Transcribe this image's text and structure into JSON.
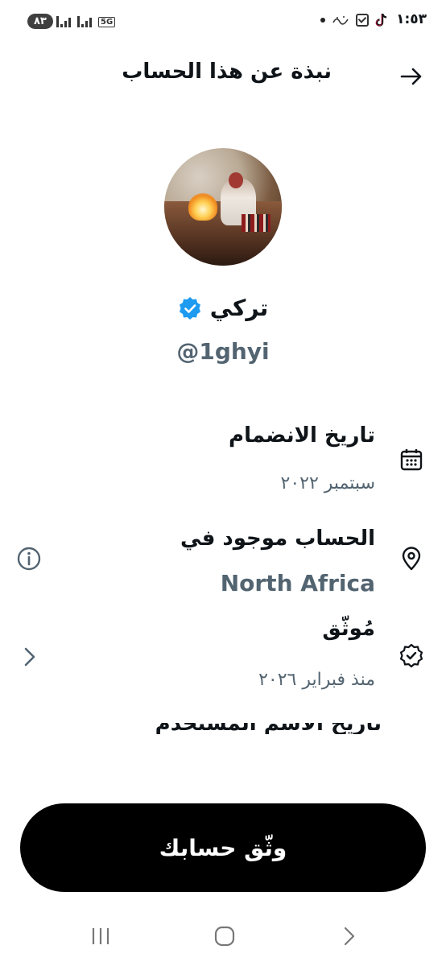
{
  "status_bar": {
    "time": "١:٥٣",
    "battery": "٨٣",
    "network": "5G",
    "icons": [
      "dot-icon",
      "calligraphy-notification-icon",
      "checkbox-notification-icon",
      "tiktok-icon",
      "signal-bars-icon",
      "signal-bars-icon",
      "battery-icon"
    ]
  },
  "header": {
    "title": "نبذة عن هذا الحساب",
    "back_icon": "arrow-right-icon"
  },
  "profile": {
    "name": "تركي",
    "handle": "@1ghyi",
    "verified_icon": "verified-badge-icon",
    "verified_color": "#1d9bf0"
  },
  "info": {
    "joined": {
      "label": "تاريخ الانضمام",
      "value": "سبتمبر ٢٠٢٢",
      "icon": "calendar-icon"
    },
    "location": {
      "label": "الحساب موجود في",
      "value": "North Africa",
      "icon": "location-pin-icon",
      "side_icon": "info-circle-icon"
    },
    "verified": {
      "label": "مُوثّق",
      "value": "منذ فبراير ٢٠٢٦",
      "icon": "verified-outline-icon",
      "side_icon": "chevron-right-icon"
    },
    "next_cut": "تاريخ الاسم المستخدم"
  },
  "cta": {
    "label": "وثّق حسابك"
  },
  "nav": {
    "icons": [
      "recent-apps-icon",
      "home-icon",
      "back-icon"
    ]
  },
  "colors": {
    "text": "#0f1419",
    "secondary": "#536471",
    "button": "#000000"
  }
}
